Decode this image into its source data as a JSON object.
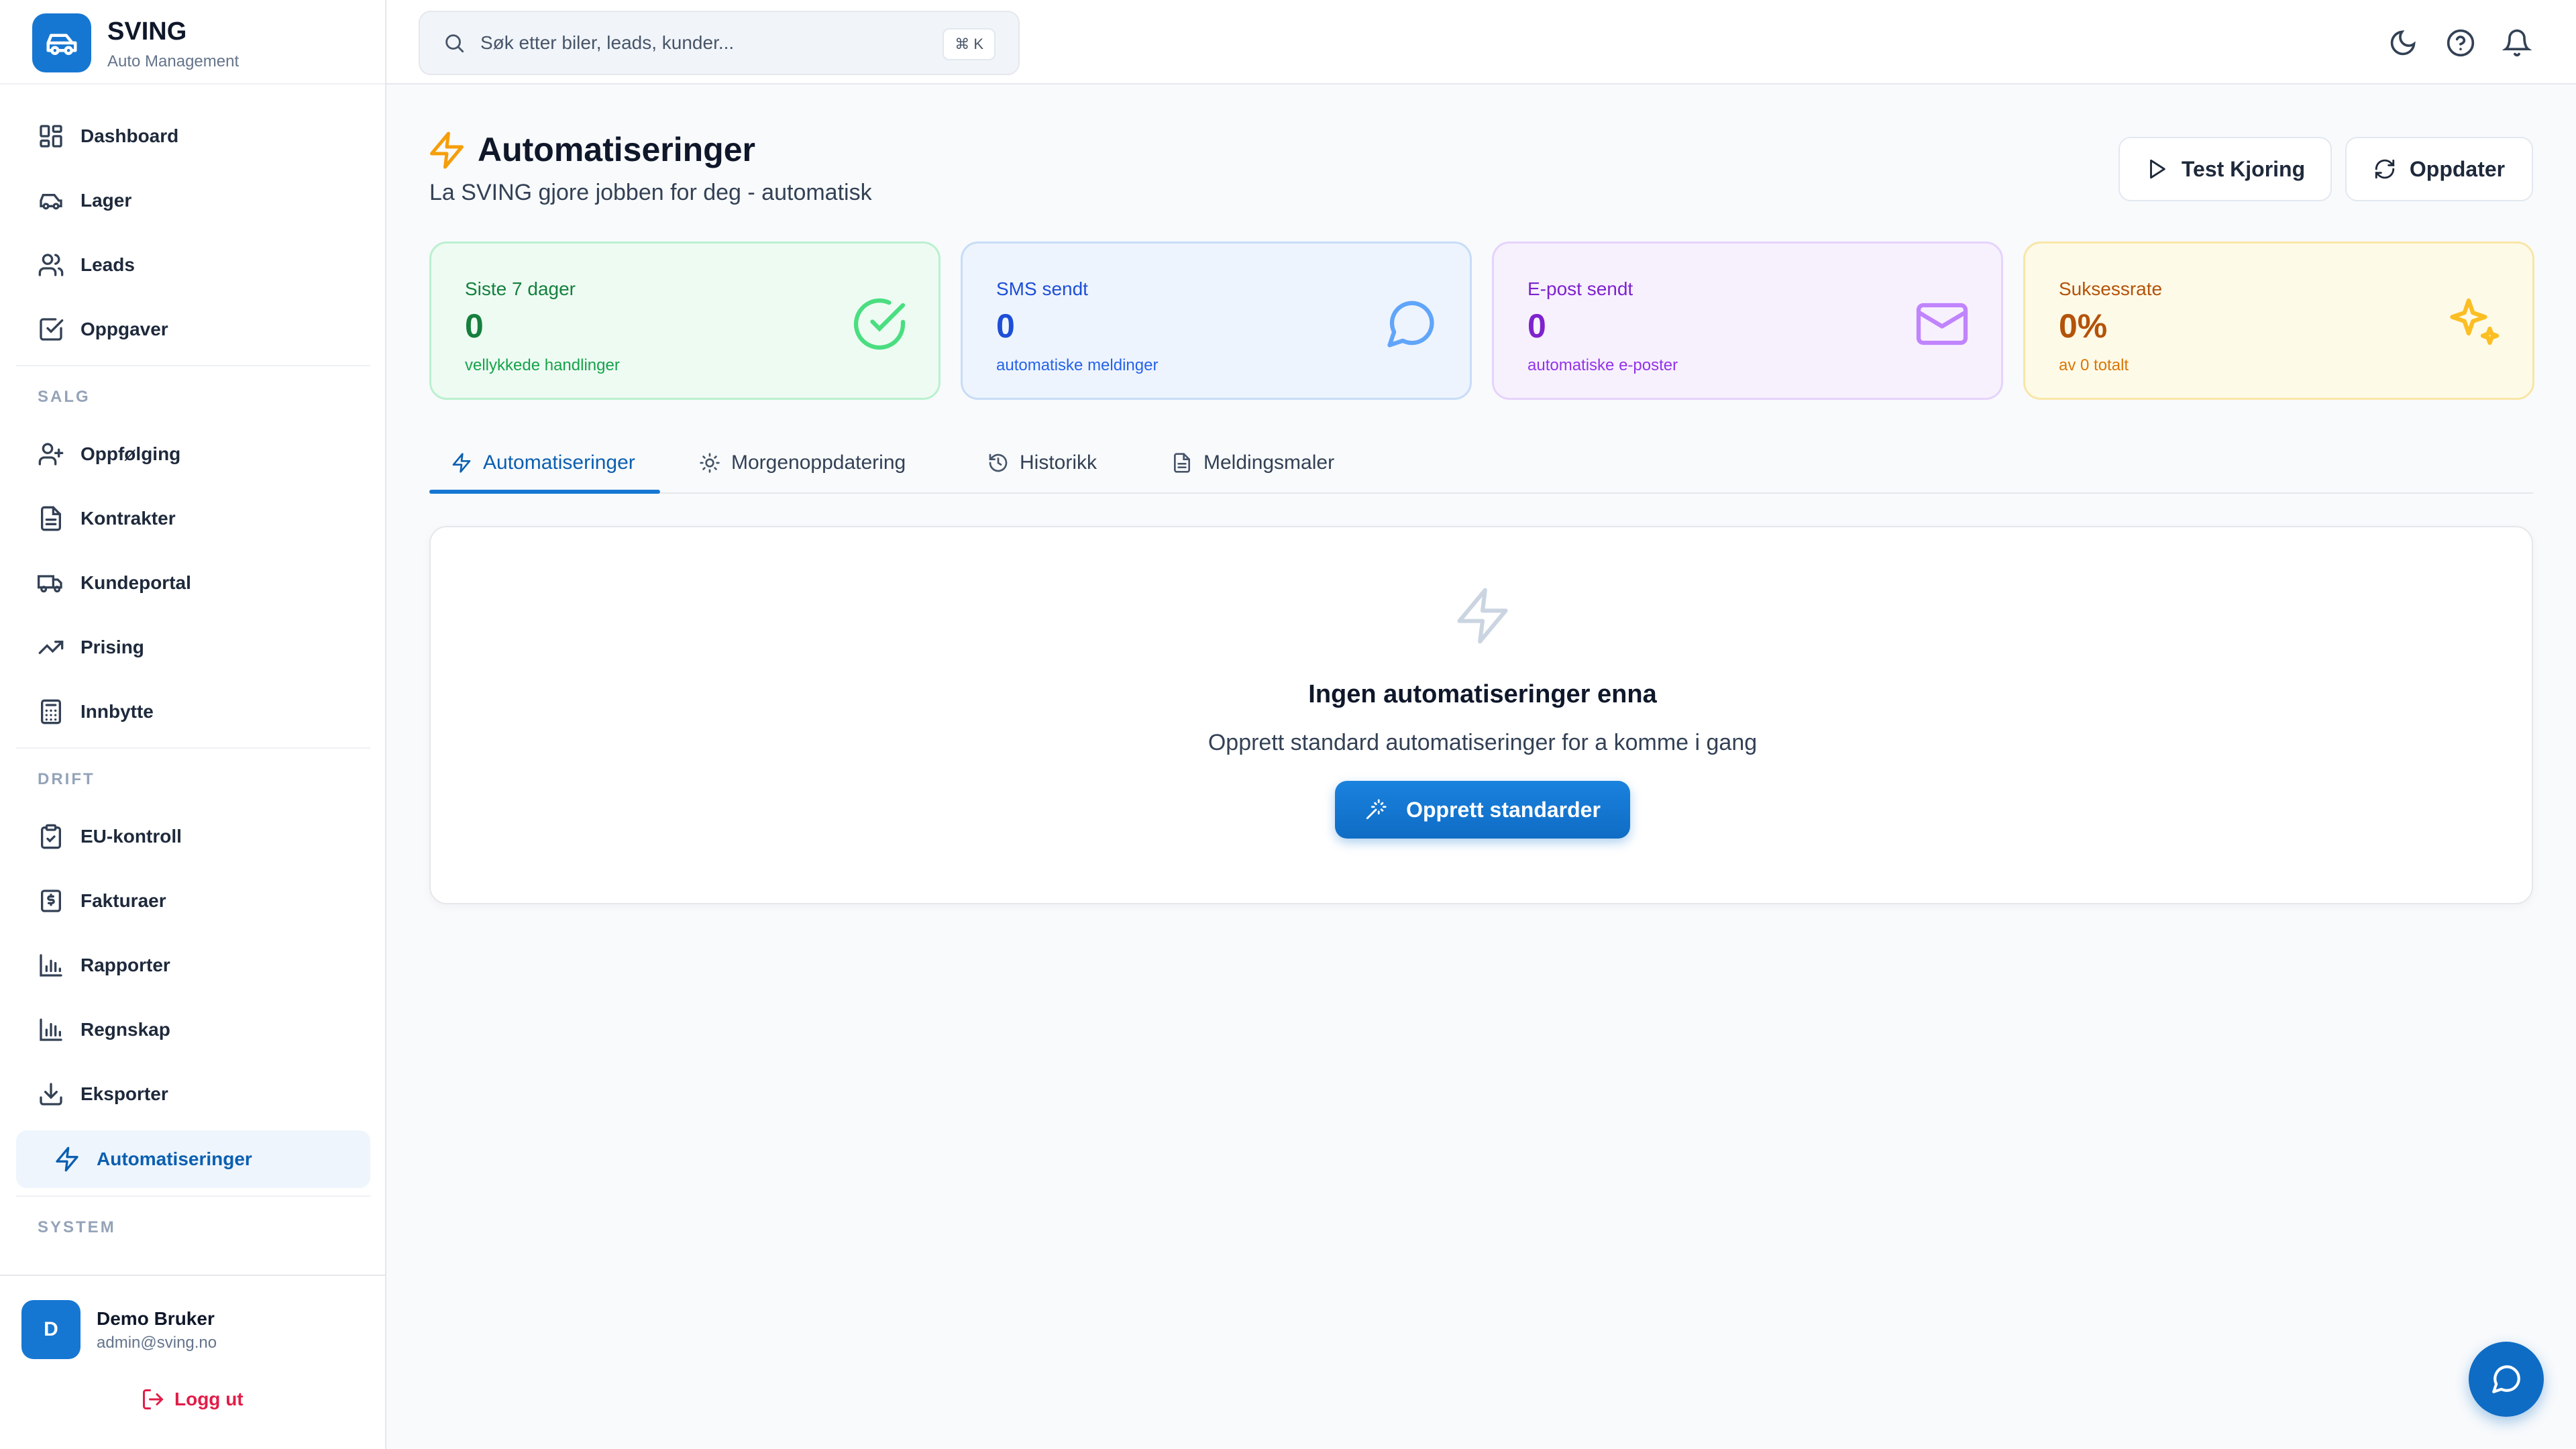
{
  "brand": {
    "name": "SVING",
    "subtitle": "Auto Management"
  },
  "search": {
    "placeholder": "Søk etter biler, leads, kunder...",
    "shortcut": "⌘ K"
  },
  "sidebar": {
    "main_items": [
      {
        "label": "Dashboard",
        "icon": "dashboard-icon"
      },
      {
        "label": "Lager",
        "icon": "car-icon"
      },
      {
        "label": "Leads",
        "icon": "users-icon"
      },
      {
        "label": "Oppgaver",
        "icon": "checkbox-icon"
      }
    ],
    "sections": {
      "salg": "SALG",
      "drift": "DRIFT",
      "system": "SYSTEM"
    },
    "salg_items": [
      {
        "label": "Oppfølging",
        "icon": "user-plus-icon"
      },
      {
        "label": "Kontrakter",
        "icon": "document-icon"
      },
      {
        "label": "Kundeportal",
        "icon": "truck-icon"
      },
      {
        "label": "Prising",
        "icon": "trending-up-icon"
      },
      {
        "label": "Innbytte",
        "icon": "calculator-icon"
      }
    ],
    "drift_items": [
      {
        "label": "EU-kontroll",
        "icon": "clipboard-check-icon"
      },
      {
        "label": "Fakturaer",
        "icon": "invoice-icon"
      },
      {
        "label": "Rapporter",
        "icon": "bar-chart-icon"
      },
      {
        "label": "Regnskap",
        "icon": "bar-chart-icon"
      },
      {
        "label": "Eksporter",
        "icon": "download-icon"
      },
      {
        "label": "Automatiseringer",
        "icon": "lightning-icon",
        "active": true
      }
    ]
  },
  "user": {
    "initial": "D",
    "name": "Demo Bruker",
    "email": "admin@sving.no",
    "logout": "Logg ut"
  },
  "page": {
    "title": "Automatiseringer",
    "subtitle": "La SVING gjore jobben for deg - automatisk",
    "test_button": "Test Kjoring",
    "refresh_button": "Oppdater"
  },
  "stats": [
    {
      "label": "Siste 7 dager",
      "value": "0",
      "caption": "vellykkede handlinger",
      "icon": "check-circle-icon",
      "color": "#15803d"
    },
    {
      "label": "SMS sendt",
      "value": "0",
      "caption": "automatiske meldinger",
      "icon": "chat-bubble-icon",
      "color": "#1d4ed8"
    },
    {
      "label": "E-post sendt",
      "value": "0",
      "caption": "automatiske e-poster",
      "icon": "mail-icon",
      "color": "#7e22ce"
    },
    {
      "label": "Suksessrate",
      "value": "0%",
      "caption": "av 0 totalt",
      "icon": "sparkles-icon",
      "color": "#b45309"
    }
  ],
  "tabs": [
    {
      "label": "Automatiseringer",
      "icon": "lightning-icon",
      "active": true
    },
    {
      "label": "Morgenoppdatering",
      "icon": "sun-icon"
    },
    {
      "label": "Historikk",
      "icon": "history-icon"
    },
    {
      "label": "Meldingsmaler",
      "icon": "document-icon"
    }
  ],
  "empty_state": {
    "title": "Ingen automatiseringer enna",
    "subtitle": "Opprett standard automatiseringer for a komme i gang",
    "button": "Opprett standarder"
  },
  "colors": {
    "accent": "#1677d2",
    "logout": "#e11d48",
    "title_icon": "#f59e0b"
  }
}
